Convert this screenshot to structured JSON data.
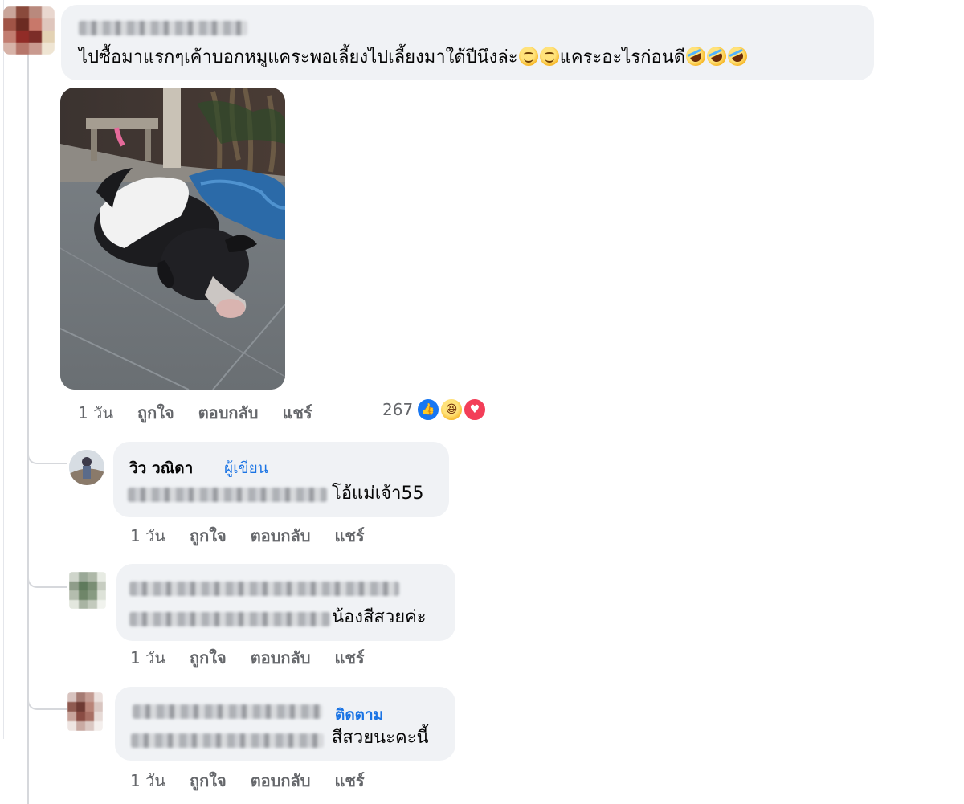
{
  "main_comment": {
    "author_name": "",
    "text": "ไปซื้อมาแรกๆเค้าบอกหมูแคระพอเลี้ยงไปเลี้ยงมาใด้ปีนึงล่ะ",
    "text_after_emoji": "แคระอะไรก่อนดี",
    "emojis_mid": [
      "grinning-face-icon",
      "grinning-face-icon"
    ],
    "emojis_end": [
      "rofl-icon",
      "rofl-icon",
      "rofl-icon"
    ],
    "photo_alt": "black and white pig lying on tiled floor",
    "timestamp": "1 วัน",
    "like_label": "ถูกใจ",
    "reply_label": "ตอบกลับ",
    "share_label": "แชร์",
    "reaction_count": "267",
    "reactions": [
      "like",
      "haha",
      "love"
    ]
  },
  "replies": [
    {
      "author_name": "วิว วณิดา",
      "badge": "ผู้เขียน",
      "text": "โอ้แม่เจ้า55",
      "timestamp": "1 วัน",
      "like_label": "ถูกใจ",
      "reply_label": "ตอบกลับ",
      "share_label": "แชร์"
    },
    {
      "author_name": "",
      "text": "น้องสีสวยค่ะ",
      "timestamp": "1 วัน",
      "like_label": "ถูกใจ",
      "reply_label": "ตอบกลับ",
      "share_label": "แชร์"
    },
    {
      "author_name": "",
      "follow_label": "ติดตาม",
      "text": "สีสวยนะคะนี้",
      "timestamp": "1 วัน",
      "like_label": "ถูกใจ",
      "reply_label": "ตอบกลับ",
      "share_label": "แชร์"
    }
  ],
  "colors": {
    "bubble_bg": "#f0f2f5",
    "link_blue": "#1b74e4",
    "meta_gray": "#65676b",
    "like_blue": "#1877f2",
    "love_red": "#f33e58"
  }
}
